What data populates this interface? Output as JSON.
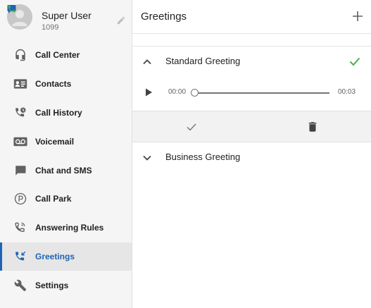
{
  "profile": {
    "name": "Super User",
    "extension": "1099"
  },
  "sidebar": {
    "items": [
      {
        "label": "Call Center",
        "icon": "headset-icon"
      },
      {
        "label": "Contacts",
        "icon": "contact-card-icon"
      },
      {
        "label": "Call History",
        "icon": "call-history-icon"
      },
      {
        "label": "Voicemail",
        "icon": "voicemail-icon"
      },
      {
        "label": "Chat and SMS",
        "icon": "chat-icon"
      },
      {
        "label": "Call Park",
        "icon": "parking-icon"
      },
      {
        "label": "Answering Rules",
        "icon": "answering-rules-icon"
      },
      {
        "label": "Greetings",
        "icon": "greetings-icon",
        "active": true
      },
      {
        "label": "Settings",
        "icon": "wrench-icon"
      }
    ]
  },
  "main": {
    "title": "Greetings",
    "greetings": [
      {
        "label": "Standard Greeting",
        "expanded": true,
        "selected": true
      },
      {
        "label": "Business Greeting",
        "expanded": false,
        "selected": false
      }
    ],
    "player": {
      "current_time": "00:00",
      "duration": "00:03",
      "progress": 0
    }
  },
  "colors": {
    "accent": "#1e64b4",
    "check_green": "#4caf50",
    "icon_gray": "#616161"
  }
}
